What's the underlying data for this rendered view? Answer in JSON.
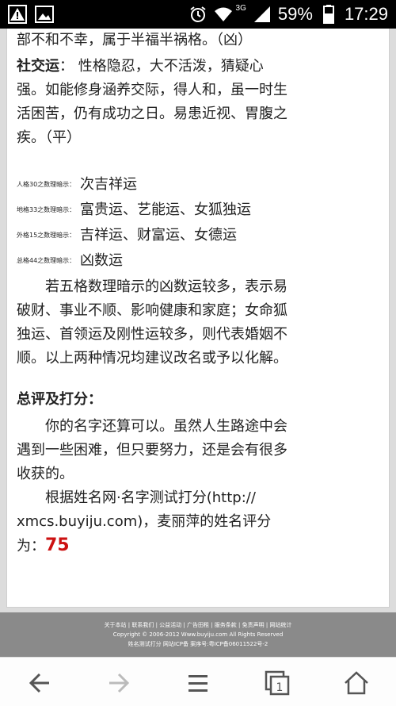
{
  "status_bar": {
    "network": "3G",
    "battery": "59%",
    "time": "17:29",
    "icons": [
      "alert-icon",
      "image-icon",
      "alarm-icon",
      "wifi-icon",
      "signal-icon",
      "battery-icon"
    ]
  },
  "article": {
    "line_top": "部不和不幸，属于半福半祸格。（凶）",
    "social": {
      "label": "社交运",
      "text1": "：  性格隐忍，大不活泼，猜疑心",
      "line2": "强。如能修身涵养交际，得人和，虽一时生",
      "line3": "活困苦，仍有成功之日。易患近视、胃腹之",
      "line4": "疾。（平）"
    },
    "hints": [
      {
        "label": "人格30之数理暗示：",
        "value": "次吉祥运"
      },
      {
        "label": "地格33之数理暗示：",
        "value": "富贵运、艺能运、女狐独运"
      },
      {
        "label": "外格15之数理暗示：",
        "value": "吉祥运、财富运、女德运"
      },
      {
        "label": "总格44之数理暗示：",
        "value": "凶数运"
      }
    ],
    "warning": {
      "line1": "若五格数理暗示的凶数运较多，表示易",
      "line2": "破财、事业不顺、影响健康和家庭；女命狐",
      "line3": "独运、首领运及刚性运较多，则代表婚姻不",
      "line4": "顺。以上两种情况均建议改名或予以化解。"
    },
    "summary_title": "总评及打分：",
    "summary": {
      "line1": "你的名字还算可以。虽然人生路途中会",
      "line2": "遇到一些困难，但只要努力，还是会有很多",
      "line3": "收获的。",
      "line4": "根据姓名网·名字测试打分(http://",
      "line5": "xmcs.buyiju.com)，麦丽萍的姓名评分",
      "line6_prefix": "为：",
      "score": "75"
    }
  },
  "footer": {
    "links": "关于本站 | 联系我们 | 公益活动 | 广告田租 | 服务条款 | 免责声明 | 网站统计",
    "copyright": "Copyright © 2006-2012 Www.buyiju.com All Rights Reserved",
    "icp": "姓名测试打分   网站ICP备 案序号:粤ICP备06011522号-2"
  },
  "navbar": {
    "buttons": [
      "back-icon",
      "forward-icon",
      "menu-icon",
      "tabs-icon",
      "home-icon"
    ],
    "tab_count": "1"
  },
  "colors": {
    "score": "#cc1111",
    "footer_bg": "#8a8a8a",
    "status_bg": "#000000"
  }
}
